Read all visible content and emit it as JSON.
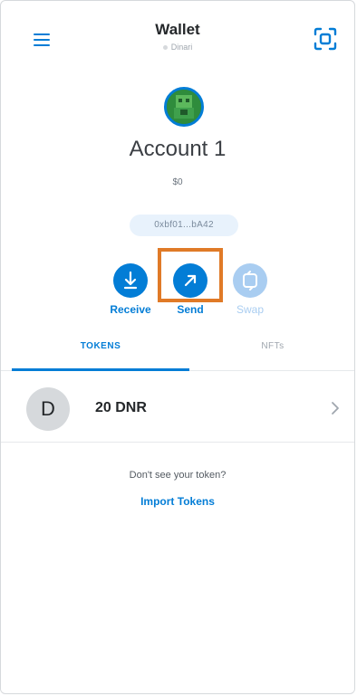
{
  "header": {
    "title": "Wallet",
    "network": "Dinari",
    "menu_icon": "hamburger-menu-icon",
    "scan_icon": "qr-scan-icon"
  },
  "account": {
    "name": "Account 1",
    "balance": "$0",
    "address": "0xbf01...bA42",
    "avatar_icon": "identicon-avatar"
  },
  "actions": [
    {
      "label": "Receive",
      "icon": "download-arrow-icon",
      "enabled": true
    },
    {
      "label": "Send",
      "icon": "arrow-up-right-icon",
      "enabled": true
    },
    {
      "label": "Swap",
      "icon": "swap-icon",
      "enabled": false
    }
  ],
  "tabs": [
    {
      "label": "TOKENS",
      "active": true
    },
    {
      "label": "NFTs",
      "active": false
    }
  ],
  "tokens": [
    {
      "initial": "D",
      "amount": "20 DNR"
    }
  ],
  "footer": {
    "prompt": "Don't see your token?",
    "import_label": "Import Tokens"
  },
  "colors": {
    "accent": "#037dd6",
    "highlight": "#e07a27",
    "disabled": "#a9cdf1"
  }
}
